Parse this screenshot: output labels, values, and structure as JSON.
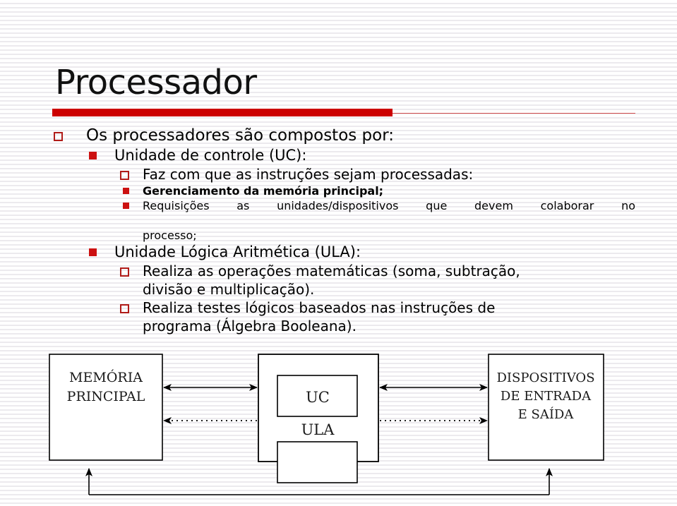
{
  "slide": {
    "title": "Processador",
    "accent_color": "#cc0000",
    "bullet_hollow_color": "#b01b18",
    "bullet_filled_color": "#cc1111",
    "background_color": "#ffffff"
  },
  "bullets": [
    {
      "level": 1,
      "marker": "hollow-square",
      "text": "Os processadores são compostos por:"
    },
    {
      "level": 2,
      "marker": "filled-square",
      "text": "Unidade de controle (UC):"
    },
    {
      "level": 3,
      "marker": "hollow-square",
      "text": "Faz com que as instruções sejam processadas:"
    },
    {
      "level": 4,
      "marker": "filled-square",
      "bold": true,
      "text": "Gerenciamento da memória principal;"
    },
    {
      "level": 4,
      "marker": "filled-square",
      "justified": true,
      "text": "Requisições as unidades/dispositivos que devem colaborar no",
      "text_line2": "processo;"
    },
    {
      "level": 2,
      "marker": "filled-square",
      "text": "Unidade Lógica Aritmética (ULA):"
    },
    {
      "level": 3,
      "marker": "hollow-square",
      "text": "Realiza as operações matemáticas (soma, subtração,",
      "text_line2": "divisão e multiplicação)."
    },
    {
      "level": 3,
      "marker": "hollow-square",
      "text": "Realiza testes lógicos baseados nas instruções de",
      "text_line2": "programa (Álgebra Booleana)."
    }
  ],
  "diagram": {
    "boxes": [
      {
        "id": "memoria",
        "lines": [
          "MEMÓRIA",
          "PRINCIPAL"
        ]
      },
      {
        "id": "cpu",
        "lines": []
      },
      {
        "id": "uc",
        "lines": [
          "UC"
        ]
      },
      {
        "id": "ula",
        "lines": [
          "ULA"
        ]
      },
      {
        "id": "es",
        "lines": [
          "DISPOSITIVOS",
          "DE ENTRADA",
          "E SAÍDA"
        ]
      }
    ],
    "connections": [
      {
        "from": "memoria",
        "to": "cpu",
        "style": "solid",
        "arrows": "both"
      },
      {
        "from": "cpu",
        "to": "memoria",
        "style": "dotted",
        "arrows": "left"
      },
      {
        "from": "cpu",
        "to": "es",
        "style": "solid",
        "arrows": "both"
      },
      {
        "from": "cpu",
        "to": "es",
        "style": "dotted",
        "arrows": "right"
      },
      {
        "from": "es",
        "to": "memoria",
        "style": "solid",
        "arrows": "both-up",
        "path": "bottom-bus"
      }
    ]
  }
}
